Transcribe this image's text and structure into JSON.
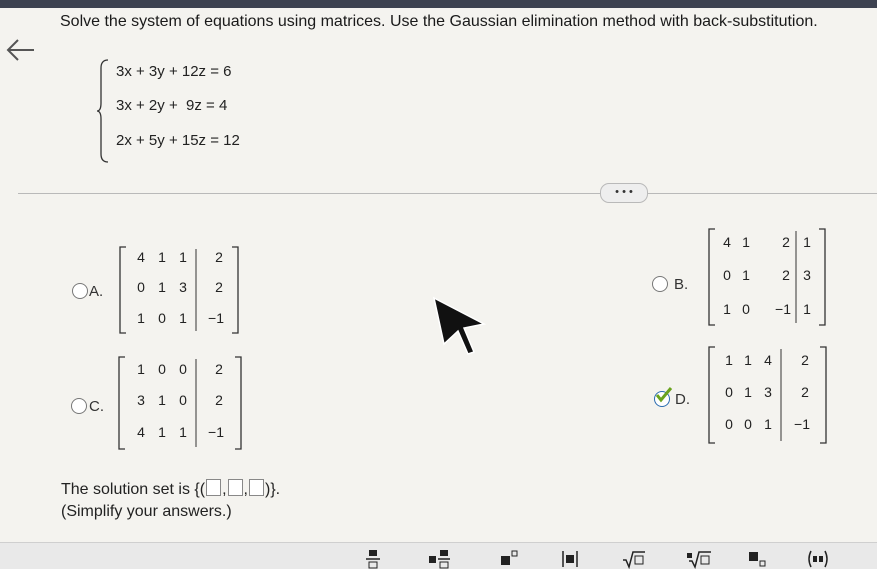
{
  "question": "Solve the system of equations using matrices. Use the Gaussian elimination method with back-substitution.",
  "system": {
    "equations": [
      "3x + 3y + 12z = 6",
      "3x + 2y +  9z = 4",
      "2x + 5y + 15z = 12"
    ]
  },
  "more_label": "• • •",
  "options": [
    {
      "letter": "A.",
      "rows": [
        [
          "4",
          "1",
          "1",
          "2"
        ],
        [
          "0",
          "1",
          "3",
          "2"
        ],
        [
          "1",
          "0",
          "1",
          "−1"
        ]
      ]
    },
    {
      "letter": "B.",
      "rows": [
        [
          "4",
          "1",
          "2",
          "1"
        ],
        [
          "0",
          "1",
          "2",
          "3"
        ],
        [
          "1",
          "0",
          "−1",
          "1"
        ]
      ]
    },
    {
      "letter": "C.",
      "rows": [
        [
          "1",
          "0",
          "0",
          "2"
        ],
        [
          "3",
          "1",
          "0",
          "2"
        ],
        [
          "4",
          "1",
          "1",
          "−1"
        ]
      ]
    },
    {
      "letter": "D.",
      "rows": [
        [
          "1",
          "1",
          "4",
          "2"
        ],
        [
          "0",
          "1",
          "3",
          "2"
        ],
        [
          "0",
          "0",
          "1",
          "−1"
        ]
      ]
    }
  ],
  "selected_option": "D.",
  "solution": {
    "prefix": "The solution set is",
    "open": "{(",
    "sep1": ",",
    "sep2": ",",
    "close": ")}."
  },
  "hint": "(Simplify your answers.)",
  "toolbar": {
    "icons": [
      "fraction-icon",
      "mixed-number-icon",
      "exponent-icon",
      "absolute-value-icon",
      "square-root-icon",
      "nth-root-icon",
      "subscript-icon",
      "ordered-pair-icon"
    ]
  },
  "colors": {
    "topbar": "#3d4250",
    "check_green": "#6aa31e",
    "highlight_blue": "#2b6cb0"
  }
}
